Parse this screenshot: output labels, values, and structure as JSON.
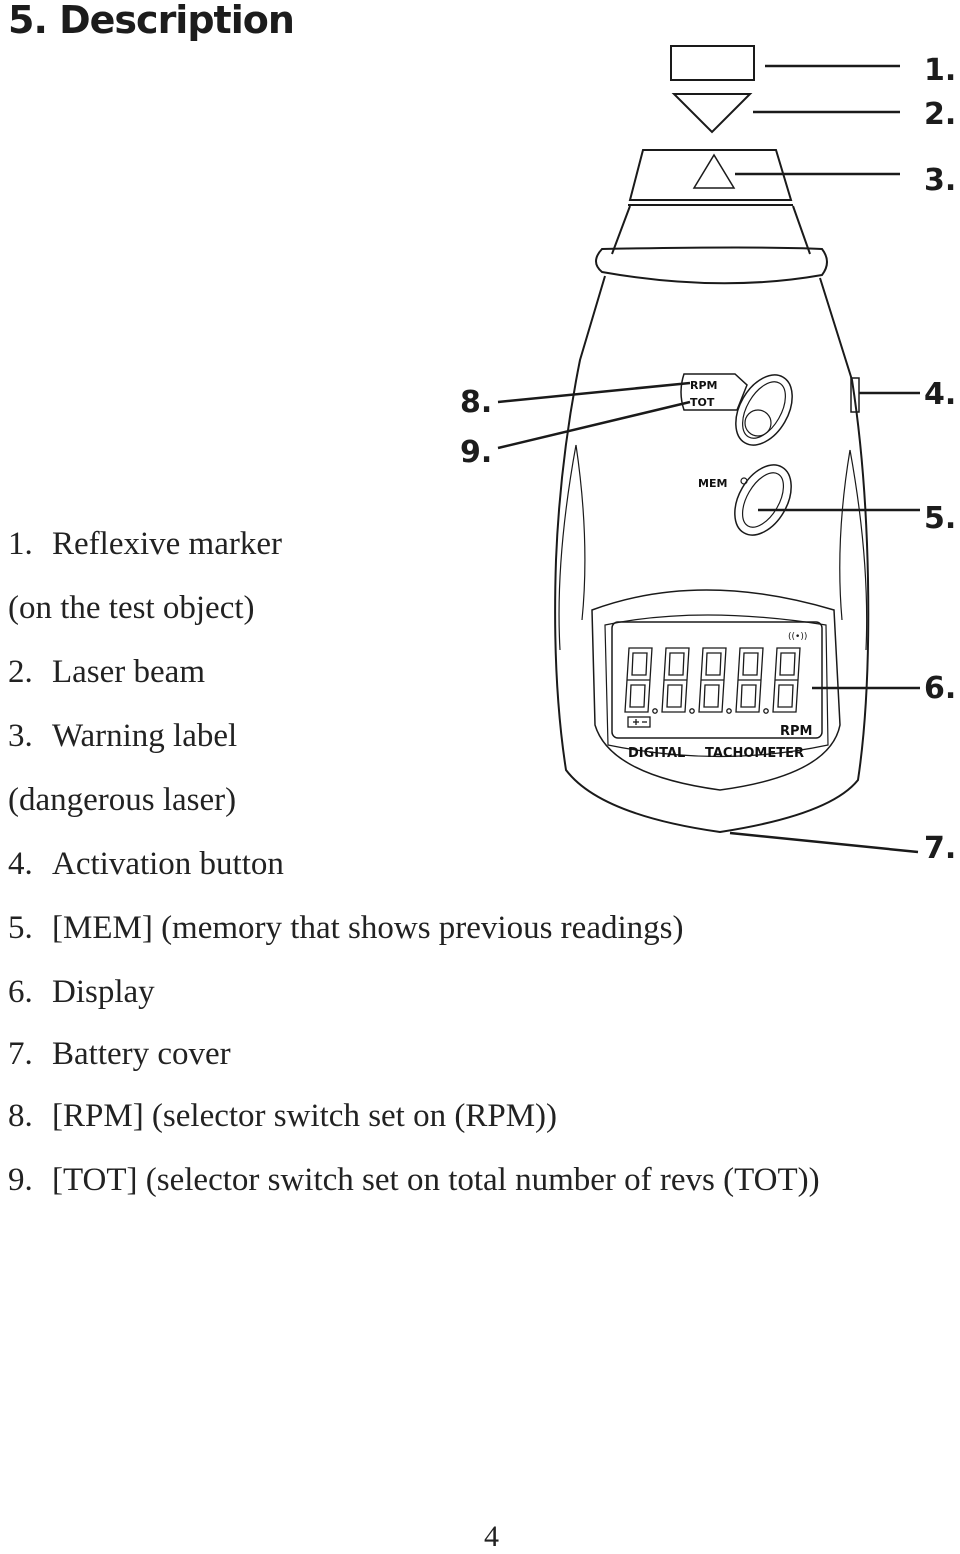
{
  "page": {
    "title": "5. Description",
    "page_number": "4"
  },
  "description_list": [
    {
      "num": "1.",
      "text": "Reflexive marker"
    },
    {
      "num": "",
      "text": "(on the test object)"
    },
    {
      "num": "2.",
      "text": "Laser beam"
    },
    {
      "num": "3.",
      "text": "Warning label"
    },
    {
      "num": "",
      "text": "(dangerous laser)"
    },
    {
      "num": "4.",
      "text": "Activation button"
    },
    {
      "num": "5.",
      "text": "[MEM] (memory that shows previous readings)"
    },
    {
      "num": "6.",
      "text": "Display"
    },
    {
      "num": "7.",
      "text": "Battery cover"
    },
    {
      "num": "8.",
      "text": "[RPM] (selector switch set on (RPM))"
    },
    {
      "num": "9.",
      "text": "[TOT] (selector switch set on total number of revs (TOT))"
    }
  ],
  "diagram": {
    "callouts": [
      "1.",
      "2.",
      "3.",
      "4.",
      "5.",
      "6.",
      "7.",
      "8.",
      "9."
    ],
    "device_labels": {
      "switch_rpm": "RPM",
      "switch_tot": "TOT",
      "mem_button": "MEM",
      "lcd_unit": "RPM",
      "lcd_brand_left": "DIGITAL",
      "lcd_brand_right": "TACHOMETER"
    },
    "lcd_digit_count": 5
  }
}
